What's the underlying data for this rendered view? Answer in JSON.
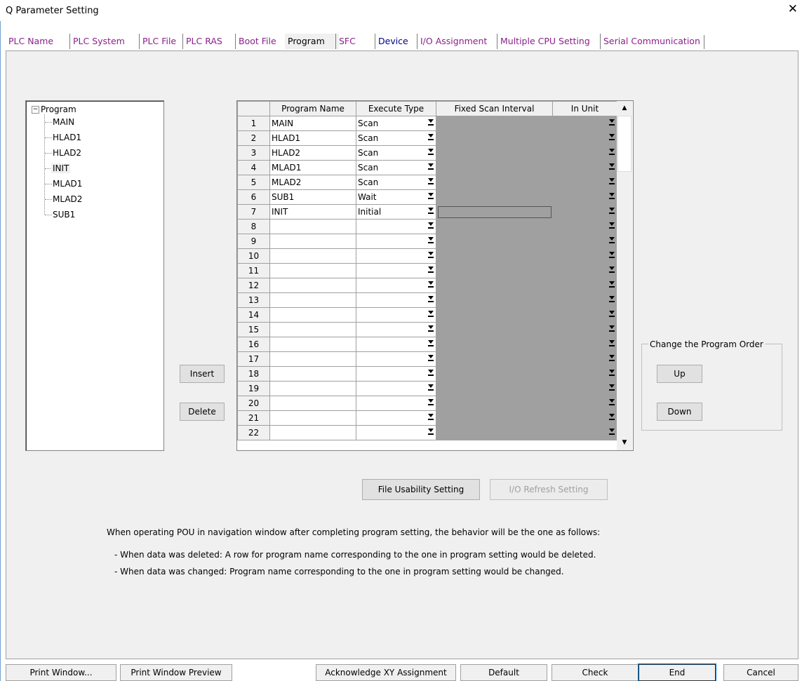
{
  "window": {
    "title": "Q Parameter Setting",
    "close_glyph": "✕"
  },
  "tabs": [
    {
      "label": "PLC Name"
    },
    {
      "label": "PLC System"
    },
    {
      "label": "PLC File"
    },
    {
      "label": "PLC RAS"
    },
    {
      "label": "Boot File"
    },
    {
      "label": "Program"
    },
    {
      "label": "SFC"
    },
    {
      "label": "Device"
    },
    {
      "label": "I/O Assignment"
    },
    {
      "label": "Multiple CPU Setting"
    },
    {
      "label": "Serial Communication"
    }
  ],
  "tree": {
    "root": "Program",
    "expander": "−",
    "items": [
      "MAIN",
      "HLAD1",
      "HLAD2",
      "INIT",
      "MLAD1",
      "MLAD2",
      "SUB1"
    ]
  },
  "grid": {
    "headers": {
      "num": "",
      "name": "Program Name",
      "exec": "Execute Type",
      "fixed": "Fixed Scan Interval",
      "unit": "In Unit"
    },
    "rows": [
      {
        "num": "1",
        "name": "MAIN",
        "exec": "Scan"
      },
      {
        "num": "2",
        "name": "HLAD1",
        "exec": "Scan"
      },
      {
        "num": "3",
        "name": "HLAD2",
        "exec": "Scan"
      },
      {
        "num": "4",
        "name": "MLAD1",
        "exec": "Scan"
      },
      {
        "num": "5",
        "name": "MLAD2",
        "exec": "Scan"
      },
      {
        "num": "6",
        "name": "SUB1",
        "exec": "Wait"
      },
      {
        "num": "7",
        "name": "INIT",
        "exec": "Initial"
      },
      {
        "num": "8",
        "name": "",
        "exec": ""
      },
      {
        "num": "9",
        "name": "",
        "exec": ""
      },
      {
        "num": "10",
        "name": "",
        "exec": ""
      },
      {
        "num": "11",
        "name": "",
        "exec": ""
      },
      {
        "num": "12",
        "name": "",
        "exec": ""
      },
      {
        "num": "13",
        "name": "",
        "exec": ""
      },
      {
        "num": "14",
        "name": "",
        "exec": ""
      },
      {
        "num": "15",
        "name": "",
        "exec": ""
      },
      {
        "num": "16",
        "name": "",
        "exec": ""
      },
      {
        "num": "17",
        "name": "",
        "exec": ""
      },
      {
        "num": "18",
        "name": "",
        "exec": ""
      },
      {
        "num": "19",
        "name": "",
        "exec": ""
      },
      {
        "num": "20",
        "name": "",
        "exec": ""
      },
      {
        "num": "21",
        "name": "",
        "exec": ""
      },
      {
        "num": "22",
        "name": "",
        "exec": ""
      }
    ],
    "scroll_up": "▲",
    "scroll_down": "▼"
  },
  "buttons": {
    "insert": "Insert",
    "delete": "Delete",
    "file_usability": "File Usability Setting",
    "io_refresh": "I/O Refresh Setting",
    "up": "Up",
    "down": "Down"
  },
  "order_group": {
    "label": "Change the Program Order"
  },
  "notes": {
    "line1": "When operating POU in navigation window after completing program setting, the behavior will be the one as follows:",
    "line2": "- When data was deleted: A row for program name corresponding to the one in program setting would be deleted.",
    "line3": "- When data was changed: Program name corresponding to the one in program setting would be changed."
  },
  "bottom": {
    "print_window": "Print Window...",
    "print_preview": "Print Window Preview",
    "acknowledge": "Acknowledge XY Assignment",
    "default": "Default",
    "check": "Check",
    "end": "End",
    "cancel": "Cancel"
  }
}
